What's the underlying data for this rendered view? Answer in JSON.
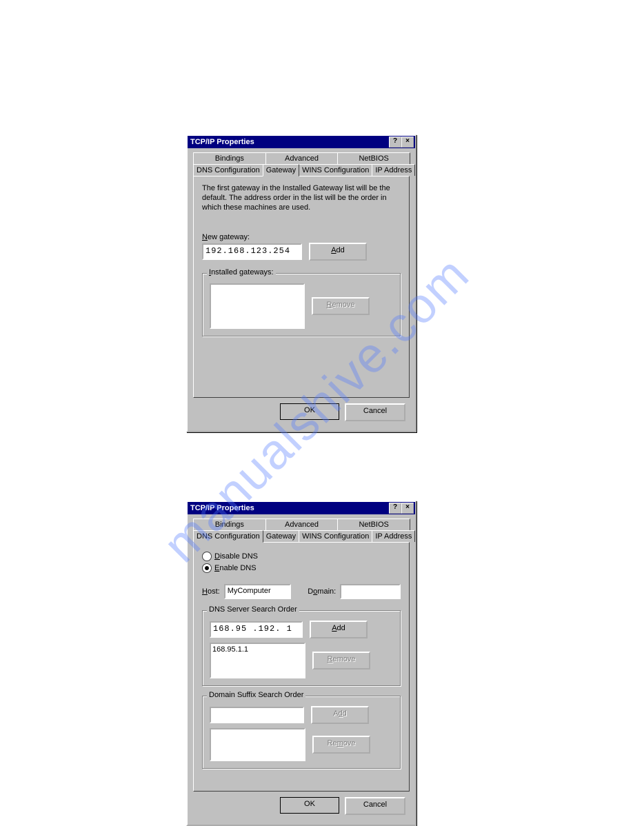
{
  "watermark": "manualshive.com",
  "dialog1": {
    "title": "TCP/IP Properties",
    "help": "?",
    "close": "×",
    "tabs_top": [
      "Bindings",
      "Advanced",
      "NetBIOS"
    ],
    "tabs_bottom": [
      "DNS Configuration",
      "Gateway",
      "WINS Configuration",
      "IP Address"
    ],
    "active_tab": "Gateway",
    "description": "The first gateway in the Installed Gateway list will be the default. The address order in the list will be the order in which these machines are used.",
    "new_gateway_label": "New gateway:",
    "new_gateway_value": "192.168.123.254",
    "add_label": "Add",
    "installed_label": "Installed gateways:",
    "remove_label": "Remove",
    "ok": "OK",
    "cancel": "Cancel"
  },
  "dialog2": {
    "title": "TCP/IP Properties",
    "help": "?",
    "close": "×",
    "tabs_top": [
      "Bindings",
      "Advanced",
      "NetBIOS"
    ],
    "tabs_bottom": [
      "DNS Configuration",
      "Gateway",
      "WINS Configuration",
      "IP Address"
    ],
    "active_tab": "DNS Configuration",
    "disable_dns": "Disable DNS",
    "enable_dns": "Enable DNS",
    "host_label": "Host:",
    "host_value": "MyComputer",
    "domain_label": "Domain:",
    "domain_value": "",
    "dns_search_label": "DNS Server Search Order",
    "dns_input": "168.95 .192. 1",
    "dns_list": "168.95.1.1",
    "suffix_label": "Domain Suffix Search Order",
    "suffix_input": "",
    "add_label": "Add",
    "remove_label": "Remove",
    "ok": "OK",
    "cancel": "Cancel"
  }
}
